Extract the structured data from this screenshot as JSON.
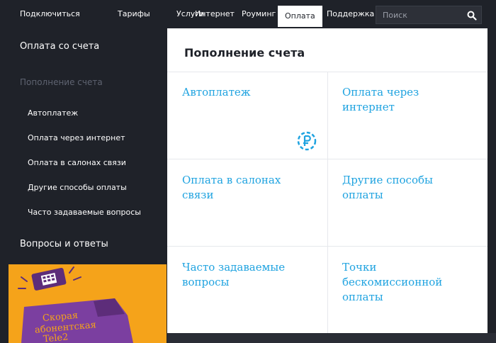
{
  "topnav": {
    "items": [
      {
        "label": "Подключиться"
      },
      {
        "label": "Тарифы"
      },
      {
        "label": "Услуги"
      },
      {
        "label": "Интернет"
      },
      {
        "label": "Роуминг"
      },
      {
        "label": "Оплата"
      },
      {
        "label": "Поддержка"
      }
    ],
    "active": "Оплата",
    "search_placeholder": "Поиск"
  },
  "sidebar": {
    "section": "Оплата со счета",
    "current": "Пополнение счета",
    "subitems": [
      {
        "label": "Автоплатеж"
      },
      {
        "label": "Оплата через интернет"
      },
      {
        "label": "Оплата в салонах связи"
      },
      {
        "label": "Другие способы оплаты"
      },
      {
        "label": "Часто задаваемые вопросы"
      }
    ],
    "faq": "Вопросы и ответы",
    "promo": {
      "line1": "Скорая",
      "line2": "абонентская",
      "line3": "Tele2"
    }
  },
  "main": {
    "title": "Пополнение счета",
    "tiles": [
      {
        "label": "Автоплатеж",
        "icon": "ruble-autopay-icon"
      },
      {
        "label": "Оплата через интернет"
      },
      {
        "label": "Оплата в салонах связи"
      },
      {
        "label": "Другие способы оплаты"
      },
      {
        "label": "Часто задаваемые вопросы"
      },
      {
        "label": "Точки бескомиссионной оплаты"
      }
    ]
  },
  "colors": {
    "background": "#1f2229",
    "accent": "#1fa3e0",
    "promo": "#f5a31a",
    "promo_van": "#7b3fa0"
  }
}
